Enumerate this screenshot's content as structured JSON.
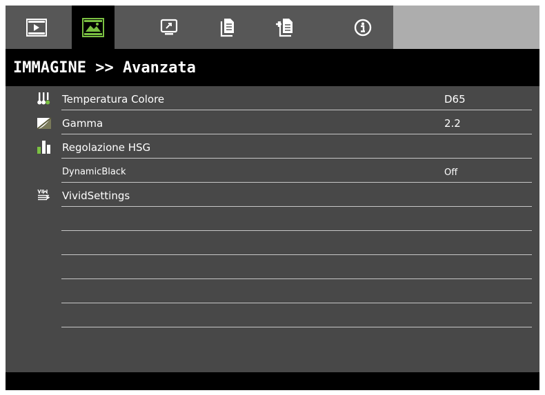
{
  "tabs": [
    {
      "name": "input-source-tab",
      "icon": "play-screen-icon",
      "active": false
    },
    {
      "name": "image-tab",
      "icon": "picture-landscape-icon",
      "active": true
    },
    {
      "name": "display-tab",
      "icon": "monitor-icon",
      "active": false
    },
    {
      "name": "setup-tab",
      "icon": "document-icon",
      "active": false
    },
    {
      "name": "options-tab",
      "icon": "document-add-icon",
      "active": false
    },
    {
      "name": "info-tab",
      "icon": "info-icon",
      "active": false
    }
  ],
  "header": {
    "title": "IMMAGINE >> Avanzata"
  },
  "menu": {
    "items": [
      {
        "label": "Temperatura Colore",
        "value": "D65",
        "icon": "color-temperature-icon"
      },
      {
        "label": "Gamma",
        "value": "2.2",
        "icon": "gamma-curve-icon"
      },
      {
        "label": "Regolazione HSG",
        "value": "",
        "icon": "hsg-bars-icon"
      },
      {
        "label": "DynamicBlack",
        "value": "Off",
        "icon": ""
      },
      {
        "label": "VividSettings",
        "value": "",
        "icon": "vivid-settings-icon"
      },
      {
        "label": "",
        "value": ""
      },
      {
        "label": "",
        "value": ""
      },
      {
        "label": "",
        "value": ""
      },
      {
        "label": "",
        "value": ""
      },
      {
        "label": "",
        "value": ""
      }
    ]
  },
  "colors": {
    "panel_bg": "#484848",
    "tab_bg": "#575757",
    "tab_active_bg": "#000000",
    "tab_filler": "#adadad",
    "accent_green": "#7bc142",
    "text": "#ffffff",
    "divider": "#c8c8c8"
  }
}
